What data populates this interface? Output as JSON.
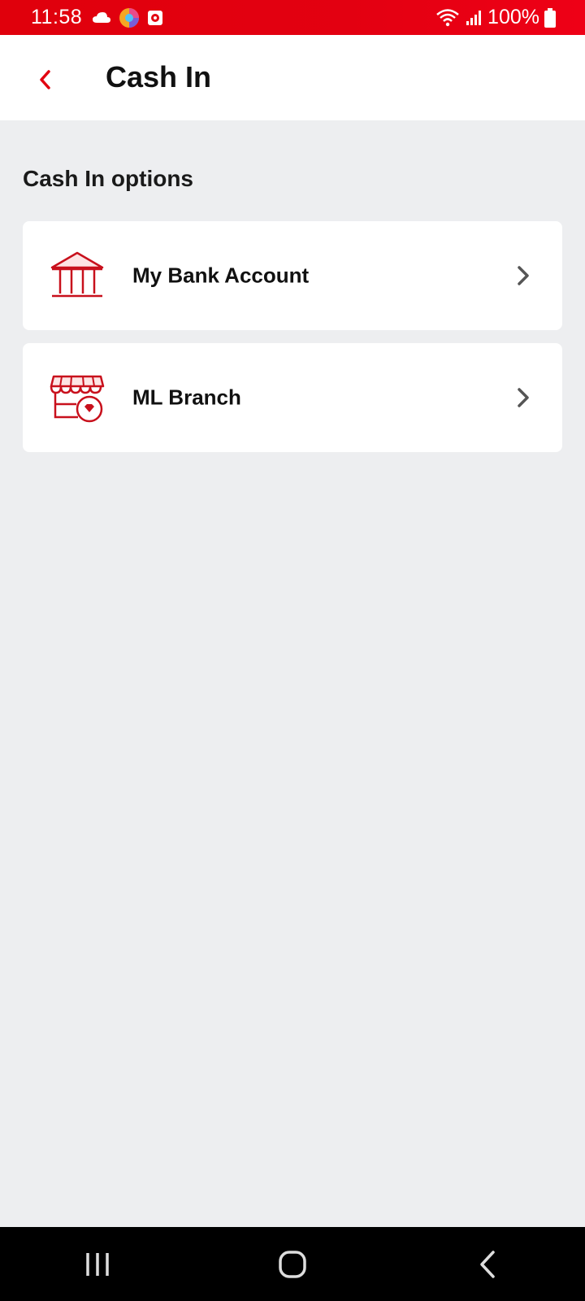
{
  "status_bar": {
    "time": "11:58",
    "battery": "100%",
    "icons": [
      "cloud-icon",
      "browser-icon",
      "recorder-icon",
      "wifi-icon",
      "signal-icon",
      "battery-icon"
    ]
  },
  "header": {
    "title": "Cash In",
    "back_icon": "chevron-left-icon"
  },
  "section": {
    "title": "Cash In options",
    "options": [
      {
        "label": "My Bank Account",
        "icon": "bank-icon"
      },
      {
        "label": "ML Branch",
        "icon": "store-branch-icon"
      }
    ]
  },
  "nav_bar": {
    "buttons": [
      "recent-apps-icon",
      "home-icon",
      "back-icon"
    ]
  },
  "colors": {
    "brand_red": "#e20010",
    "background": "#edeef0",
    "card": "#ffffff",
    "text": "#111111",
    "chevron": "#555555"
  }
}
